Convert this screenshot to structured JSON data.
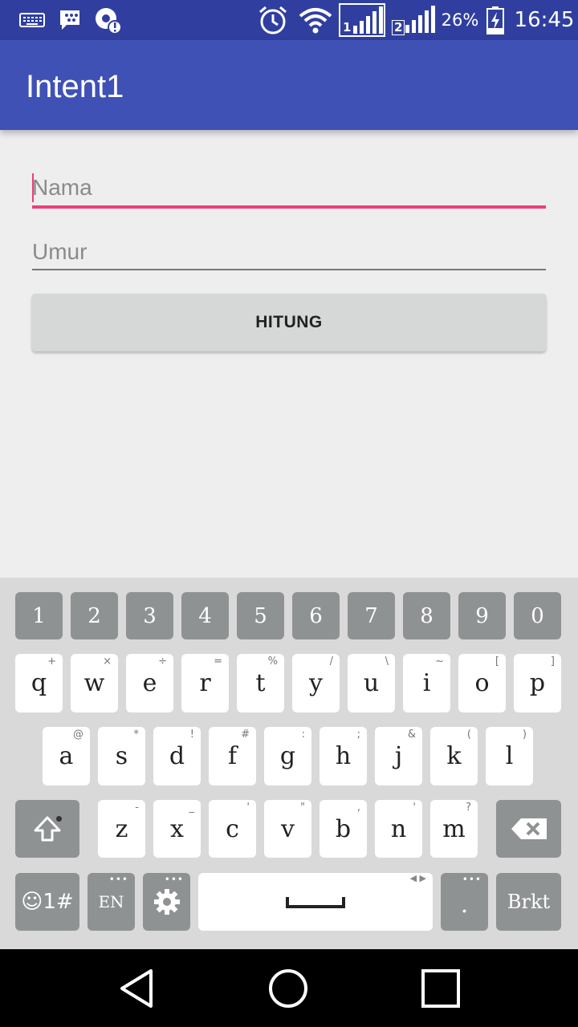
{
  "status_bar": {
    "battery_percent": "26%",
    "time": "16:45",
    "sim1_label": "1",
    "sim2_label": "2",
    "icons": [
      "keyboard-icon",
      "bbm-icon",
      "sync-alert-icon",
      "alarm-icon",
      "wifi-icon",
      "signal-sim1-icon",
      "signal-sim2-icon",
      "battery-charging-icon"
    ]
  },
  "app_bar": {
    "title": "Intent1"
  },
  "form": {
    "name_placeholder": "Nama",
    "age_placeholder": "Umur",
    "button_label": "HITUNG"
  },
  "keyboard": {
    "number_row": [
      "1",
      "2",
      "3",
      "4",
      "5",
      "6",
      "7",
      "8",
      "9",
      "0"
    ],
    "row1": [
      {
        "key": "q",
        "hint": "+"
      },
      {
        "key": "w",
        "hint": "×"
      },
      {
        "key": "e",
        "hint": "÷"
      },
      {
        "key": "r",
        "hint": "="
      },
      {
        "key": "t",
        "hint": "%"
      },
      {
        "key": "y",
        "hint": "/"
      },
      {
        "key": "u",
        "hint": "\\"
      },
      {
        "key": "i",
        "hint": "~"
      },
      {
        "key": "o",
        "hint": "["
      },
      {
        "key": "p",
        "hint": "]"
      }
    ],
    "row2": [
      {
        "key": "a",
        "hint": "@"
      },
      {
        "key": "s",
        "hint": "*"
      },
      {
        "key": "d",
        "hint": "!"
      },
      {
        "key": "f",
        "hint": "#"
      },
      {
        "key": "g",
        "hint": ":"
      },
      {
        "key": "h",
        "hint": ";"
      },
      {
        "key": "j",
        "hint": "&"
      },
      {
        "key": "k",
        "hint": "("
      },
      {
        "key": "l",
        "hint": ")"
      }
    ],
    "row3": [
      {
        "key": "z",
        "hint": "-"
      },
      {
        "key": "x",
        "hint": "_"
      },
      {
        "key": "c",
        "hint": "'"
      },
      {
        "key": "v",
        "hint": "\""
      },
      {
        "key": "b",
        "hint": ","
      },
      {
        "key": "n",
        "hint": "'"
      },
      {
        "key": "m",
        "hint": "?"
      }
    ],
    "symbols_label": "☺1#",
    "language_label": "EN",
    "period_label": ".",
    "action_label": "Brkt"
  },
  "colors": {
    "status_bar": "#303f9f",
    "app_bar": "#3f51b5",
    "accent": "#ec407a"
  }
}
